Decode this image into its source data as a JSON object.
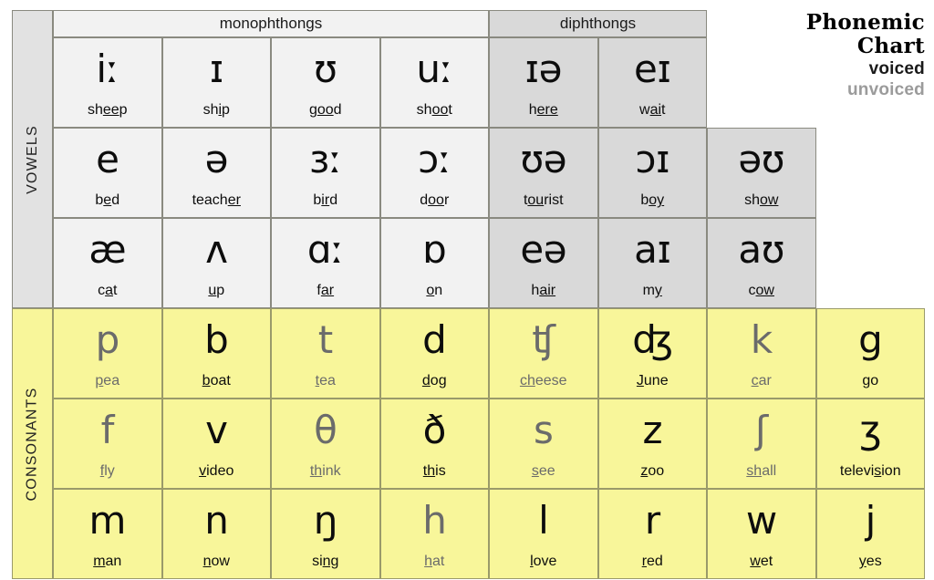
{
  "legend": {
    "title_line1": "Phonemic",
    "title_line2": "Chart",
    "voiced_label": "voiced",
    "unvoiced_label": "unvoiced",
    "voiced_color": "#1a1a1a",
    "unvoiced_color": "#9b9b9b"
  },
  "sections": {
    "vowels_label": "VOWELS",
    "consonants_label": "CONSONANTS"
  },
  "bands": {
    "monophthongs": "monophthongs",
    "diphthongs": "diphthongs"
  },
  "colors": {
    "vowel_bg": "#f2f2f2",
    "diphthong_bg": "#d9d9d9",
    "consonant_bg": "#f8f69a",
    "vowel_side_bg": "#e2e2e2",
    "grid_line": "#8a8a80"
  },
  "vowels": [
    [
      {
        "symbol": "iː",
        "word_pre": "sh",
        "word_mark": "ee",
        "word_post": "p",
        "group": "monophthong",
        "voicing": "voiced"
      },
      {
        "symbol": "ɪ",
        "word_pre": "sh",
        "word_mark": "i",
        "word_post": "p",
        "group": "monophthong",
        "voicing": "voiced"
      },
      {
        "symbol": "ʊ",
        "word_pre": "g",
        "word_mark": "oo",
        "word_post": "d",
        "group": "monophthong",
        "voicing": "voiced"
      },
      {
        "symbol": "uː",
        "word_pre": "sh",
        "word_mark": "oo",
        "word_post": "t",
        "group": "monophthong",
        "voicing": "voiced"
      },
      {
        "symbol": "ɪə",
        "word_pre": "h",
        "word_mark": "ere",
        "word_post": "",
        "group": "diphthong",
        "voicing": "voiced"
      },
      {
        "symbol": "eɪ",
        "word_pre": "w",
        "word_mark": "ai",
        "word_post": "t",
        "group": "diphthong",
        "voicing": "voiced"
      },
      {
        "symbol": "",
        "word_pre": "",
        "word_mark": "",
        "word_post": "",
        "group": "empty",
        "voicing": "voiced"
      }
    ],
    [
      {
        "symbol": "e",
        "word_pre": "b",
        "word_mark": "e",
        "word_post": "d",
        "group": "monophthong",
        "voicing": "voiced"
      },
      {
        "symbol": "ə",
        "word_pre": "teach",
        "word_mark": "er",
        "word_post": "",
        "group": "monophthong",
        "voicing": "voiced"
      },
      {
        "symbol": "ɜː",
        "word_pre": "b",
        "word_mark": "ir",
        "word_post": "d",
        "group": "monophthong",
        "voicing": "voiced"
      },
      {
        "symbol": "ɔː",
        "word_pre": "d",
        "word_mark": "oo",
        "word_post": "r",
        "group": "monophthong",
        "voicing": "voiced"
      },
      {
        "symbol": "ʊə",
        "word_pre": "t",
        "word_mark": "ou",
        "word_post": "rist",
        "group": "diphthong",
        "voicing": "voiced"
      },
      {
        "symbol": "ɔɪ",
        "word_pre": "b",
        "word_mark": "oy",
        "word_post": "",
        "group": "diphthong",
        "voicing": "voiced"
      },
      {
        "symbol": "əʊ",
        "word_pre": "sh",
        "word_mark": "ow",
        "word_post": "",
        "group": "diphthong",
        "voicing": "voiced"
      }
    ],
    [
      {
        "symbol": "æ",
        "word_pre": "c",
        "word_mark": "a",
        "word_post": "t",
        "group": "monophthong",
        "voicing": "voiced"
      },
      {
        "symbol": "ʌ",
        "word_pre": "",
        "word_mark": "u",
        "word_post": "p",
        "group": "monophthong",
        "voicing": "voiced"
      },
      {
        "symbol": "ɑː",
        "word_pre": "f",
        "word_mark": "ar",
        "word_post": "",
        "group": "monophthong",
        "voicing": "voiced"
      },
      {
        "symbol": "ɒ",
        "word_pre": "",
        "word_mark": "o",
        "word_post": "n",
        "group": "monophthong",
        "voicing": "voiced"
      },
      {
        "symbol": "eə",
        "word_pre": "h",
        "word_mark": "air",
        "word_post": "",
        "group": "diphthong",
        "voicing": "voiced"
      },
      {
        "symbol": "aɪ",
        "word_pre": "m",
        "word_mark": "y",
        "word_post": "",
        "group": "diphthong",
        "voicing": "voiced"
      },
      {
        "symbol": "aʊ",
        "word_pre": "c",
        "word_mark": "ow",
        "word_post": "",
        "group": "diphthong",
        "voicing": "voiced"
      }
    ]
  ],
  "consonants": [
    [
      {
        "symbol": "p",
        "word_pre": "",
        "word_mark": "p",
        "word_post": "ea",
        "voicing": "unvoiced"
      },
      {
        "symbol": "b",
        "word_pre": "",
        "word_mark": "b",
        "word_post": "oat",
        "voicing": "voiced"
      },
      {
        "symbol": "t",
        "word_pre": "",
        "word_mark": "t",
        "word_post": "ea",
        "voicing": "unvoiced"
      },
      {
        "symbol": "d",
        "word_pre": "",
        "word_mark": "d",
        "word_post": "og",
        "voicing": "voiced"
      },
      {
        "symbol": "ʧ",
        "word_pre": "",
        "word_mark": "ch",
        "word_post": "eese",
        "voicing": "unvoiced"
      },
      {
        "symbol": "ʤ",
        "word_pre": "",
        "word_mark": "J",
        "word_post": "une",
        "voicing": "voiced"
      },
      {
        "symbol": "k",
        "word_pre": "",
        "word_mark": "c",
        "word_post": "ar",
        "voicing": "unvoiced"
      },
      {
        "symbol": "g",
        "word_pre": "",
        "word_mark": "g",
        "word_post": "o",
        "voicing": "voiced"
      }
    ],
    [
      {
        "symbol": "f",
        "word_pre": "",
        "word_mark": "f",
        "word_post": "ly",
        "voicing": "unvoiced"
      },
      {
        "symbol": "v",
        "word_pre": "",
        "word_mark": "v",
        "word_post": "ideo",
        "voicing": "voiced"
      },
      {
        "symbol": "θ",
        "word_pre": "",
        "word_mark": "th",
        "word_post": "ink",
        "voicing": "unvoiced"
      },
      {
        "symbol": "ð",
        "word_pre": "",
        "word_mark": "th",
        "word_post": "is",
        "voicing": "voiced"
      },
      {
        "symbol": "s",
        "word_pre": "",
        "word_mark": "s",
        "word_post": "ee",
        "voicing": "unvoiced"
      },
      {
        "symbol": "z",
        "word_pre": "",
        "word_mark": "z",
        "word_post": "oo",
        "voicing": "voiced"
      },
      {
        "symbol": "ʃ",
        "word_pre": "",
        "word_mark": "sh",
        "word_post": "all",
        "voicing": "unvoiced"
      },
      {
        "symbol": "ʒ",
        "word_pre": "televi",
        "word_mark": "s",
        "word_post": "ion",
        "voicing": "voiced"
      }
    ],
    [
      {
        "symbol": "m",
        "word_pre": "",
        "word_mark": "m",
        "word_post": "an",
        "voicing": "voiced"
      },
      {
        "symbol": "n",
        "word_pre": "",
        "word_mark": "n",
        "word_post": "ow",
        "voicing": "voiced"
      },
      {
        "symbol": "ŋ",
        "word_pre": "si",
        "word_mark": "ng",
        "word_post": "",
        "voicing": "voiced"
      },
      {
        "symbol": "h",
        "word_pre": "",
        "word_mark": "h",
        "word_post": "at",
        "voicing": "unvoiced"
      },
      {
        "symbol": "l",
        "word_pre": "",
        "word_mark": "l",
        "word_post": "ove",
        "voicing": "voiced"
      },
      {
        "symbol": "r",
        "word_pre": "",
        "word_mark": "r",
        "word_post": "ed",
        "voicing": "voiced"
      },
      {
        "symbol": "w",
        "word_pre": "",
        "word_mark": "w",
        "word_post": "et",
        "voicing": "voiced"
      },
      {
        "symbol": "j",
        "word_pre": "",
        "word_mark": "y",
        "word_post": "es",
        "voicing": "voiced"
      }
    ]
  ]
}
